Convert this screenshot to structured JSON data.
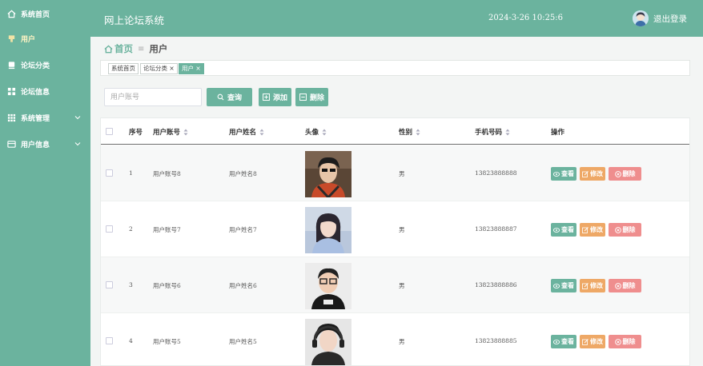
{
  "sidebar": {
    "items": [
      {
        "label": "系统首页",
        "icon": "home-icon"
      },
      {
        "label": "用户",
        "icon": "user-icon"
      },
      {
        "label": "论坛分类",
        "icon": "category-icon"
      },
      {
        "label": "论坛信息",
        "icon": "grid-icon"
      },
      {
        "label": "系统管理",
        "icon": "apps-icon"
      },
      {
        "label": "用户信息",
        "icon": "profile-icon"
      }
    ]
  },
  "header": {
    "title": "网上论坛系统",
    "datetime": "2024-3-26 10:25:6",
    "logout_label": "退出登录"
  },
  "breadcrumb": {
    "home": "首页",
    "separator": "≡",
    "current": "用户"
  },
  "tags": [
    {
      "label": "系统首页"
    },
    {
      "label": "论坛分类 ×"
    },
    {
      "label": "用户 ×"
    }
  ],
  "toolbar": {
    "search_placeholder": "用户账号",
    "query_label": "查询",
    "add_label": "添加",
    "delete_label": "删除"
  },
  "table": {
    "columns": [
      "序号",
      "用户账号",
      "用户姓名",
      "头像",
      "性别",
      "手机号码",
      "操作"
    ],
    "rows": [
      {
        "index": "1",
        "account": "用户账号8",
        "name": "用户姓名8",
        "gender": "男",
        "phone": "13823888888"
      },
      {
        "index": "2",
        "account": "用户账号7",
        "name": "用户姓名7",
        "gender": "男",
        "phone": "13823888887"
      },
      {
        "index": "3",
        "account": "用户账号6",
        "name": "用户姓名6",
        "gender": "男",
        "phone": "13823888886"
      },
      {
        "index": "4",
        "account": "用户账号5",
        "name": "用户姓名5",
        "gender": "男",
        "phone": "13823888885"
      }
    ],
    "actions": {
      "view": "查看",
      "edit": "修改",
      "delete": "删除"
    }
  },
  "colors": {
    "primary": "#6bb39e",
    "edit": "#eea866",
    "delete": "#ef8e8e"
  }
}
